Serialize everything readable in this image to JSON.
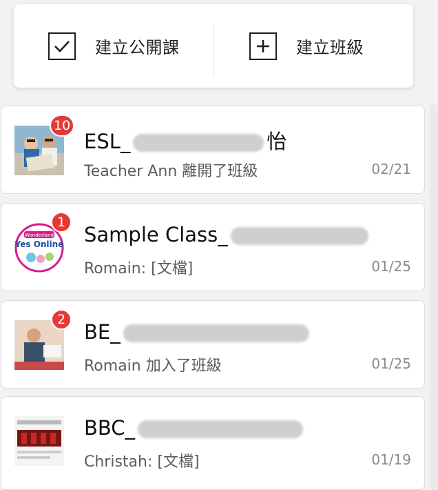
{
  "actions": {
    "open_class_label": "建立公開課",
    "new_class_label": "建立班級"
  },
  "classes": [
    {
      "title": "ESL_",
      "title_tail": "怡",
      "subtitle": "Teacher Ann 離開了班級",
      "date": "02/21",
      "badge": "10",
      "thumb": "classroom-photo"
    },
    {
      "title": "Sample Class_",
      "title_tail": "",
      "subtitle": "Romain: [文檔]",
      "date": "01/25",
      "badge": "1",
      "thumb": "yes-online-logo",
      "logo_text": "Yes Online",
      "logo_top": "Wonderland"
    },
    {
      "title": "BE_",
      "title_tail": "",
      "subtitle": "Romain 加入了班級",
      "date": "01/25",
      "badge": "2",
      "thumb": "business-photo"
    },
    {
      "title": "BBC_",
      "title_tail": "",
      "subtitle": "Christah: [文檔]",
      "date": "01/19",
      "badge": "",
      "thumb": "document-photo"
    }
  ]
}
